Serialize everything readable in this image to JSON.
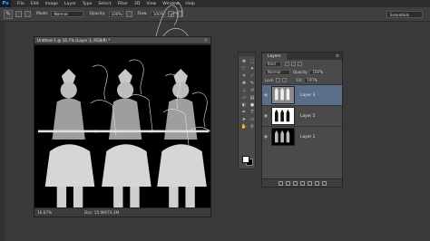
{
  "app": {
    "logo": "Ps"
  },
  "menu": [
    "File",
    "Edit",
    "Image",
    "Layer",
    "Type",
    "Select",
    "Filter",
    "3D",
    "View",
    "Window",
    "Help"
  ],
  "options": {
    "mode_label": "Mode:",
    "mode_value": "Normal",
    "opacity_label": "Opacity:",
    "opacity_value": "100%",
    "flow_label": "Flow:",
    "flow_value": "100%",
    "workspace": "Essentials"
  },
  "document": {
    "title": "Untitled-1 @ 16.7% (Layer 3, RGB/8) *",
    "zoom": "16.67%",
    "doc_info": "Doc: 15.9M/74.3M"
  },
  "layers_panel": {
    "tab": "Layers",
    "kind_filter": "Kind",
    "blend_mode": "Normal",
    "opacity_label": "Opacity:",
    "opacity_value": "100%",
    "lock_label": "Lock:",
    "fill_label": "Fill:",
    "fill_value": "100%",
    "layers": [
      {
        "name": "Layer 3",
        "active": true
      },
      {
        "name": "Layer 2",
        "active": false
      },
      {
        "name": "Layer 1",
        "active": false
      }
    ]
  },
  "colors": {
    "foreground": "#ffffff",
    "background": "#000000",
    "active_layer": "#5a6e8a"
  }
}
